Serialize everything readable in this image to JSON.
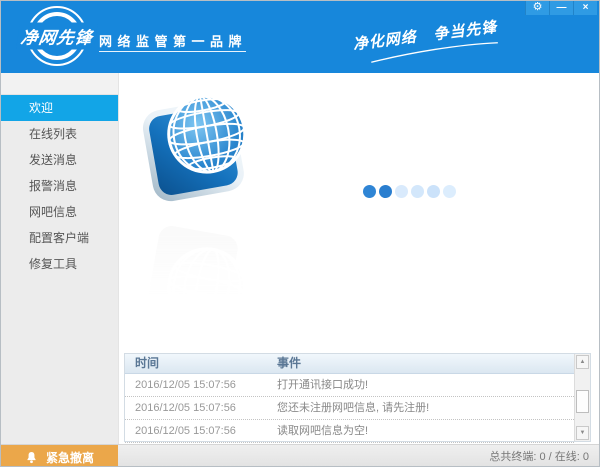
{
  "window": {
    "logo_text": "净网先锋",
    "brand_text": "网络监管第一品牌",
    "slogan": "净化网络 争当先锋",
    "controls": {
      "settings_glyph": "⚙",
      "minimize_glyph": "—",
      "close_glyph": "×"
    }
  },
  "sidebar": {
    "items": [
      {
        "label": "欢迎",
        "active": true
      },
      {
        "label": "在线列表",
        "active": false
      },
      {
        "label": "发送消息",
        "active": false
      },
      {
        "label": "报警消息",
        "active": false
      },
      {
        "label": "网吧信息",
        "active": false
      },
      {
        "label": "配置客户端",
        "active": false
      },
      {
        "label": "修复工具",
        "active": false
      }
    ]
  },
  "main": {
    "globe_icon": "globe-3d-icon",
    "loading_dots_colors": [
      "#2f85d5",
      "#2a7ecf",
      "#d9eafc",
      "#d3e7fb",
      "#cbe2fa",
      "#dcedfd"
    ]
  },
  "event_table": {
    "columns": [
      "时间",
      "事件"
    ],
    "rows": [
      {
        "time": "2016/12/05 15:07:56",
        "event": "打开通讯接口成功!"
      },
      {
        "time": "2016/12/05 15:07:56",
        "event": "您还未注册网吧信息, 请先注册!"
      },
      {
        "time": "2016/12/05 15:07:56",
        "event": "读取网吧信息为空!"
      }
    ],
    "scrollbar": {
      "up_arrow": "▲",
      "down_arrow": "▼"
    }
  },
  "footer": {
    "emergency_label": "紧急撤离",
    "status_text": "总共终端: 0 / 在线: 0"
  },
  "colors": {
    "header_blue": "#1787db",
    "active_item_blue": "#12a5e7",
    "emergency_orange": "#eba74a"
  }
}
